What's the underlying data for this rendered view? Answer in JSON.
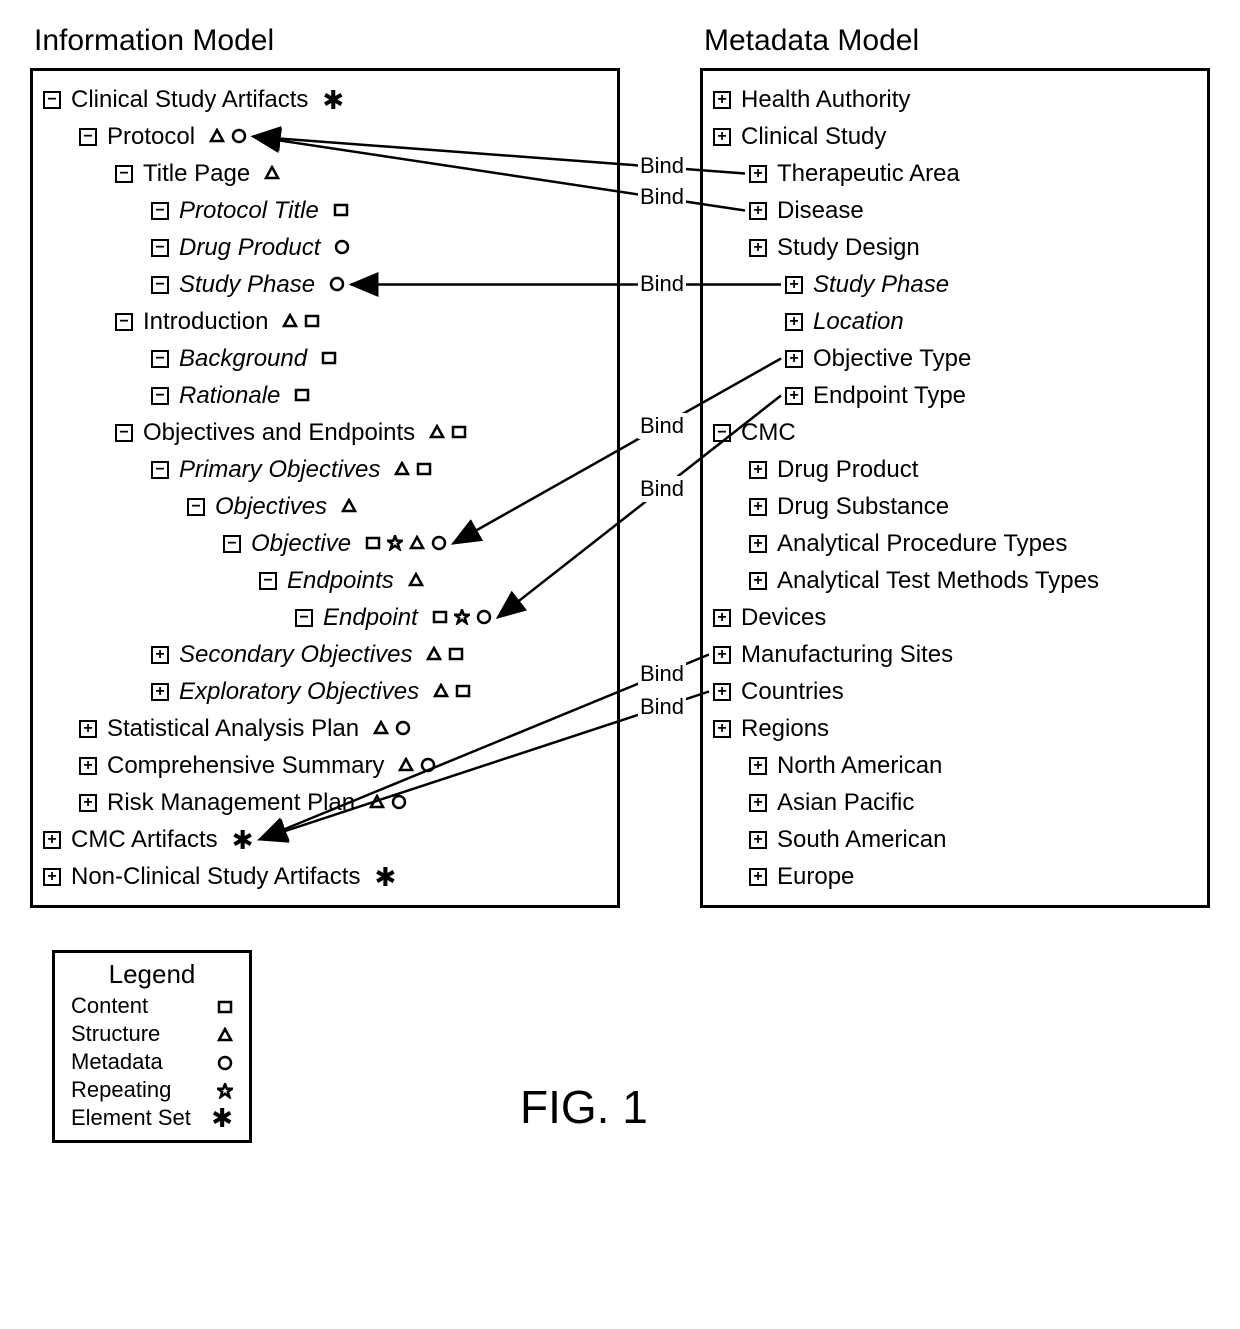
{
  "titles": {
    "information_model": "Information Model",
    "metadata_model": "Metadata Model",
    "figure": "FIG. 1"
  },
  "legend": {
    "title": "Legend",
    "items": [
      {
        "label": "Content",
        "glyph": "content"
      },
      {
        "label": "Structure",
        "glyph": "structure"
      },
      {
        "label": "Metadata",
        "glyph": "metadata"
      },
      {
        "label": "Repeating",
        "glyph": "repeating"
      },
      {
        "label": "Element Set",
        "glyph": "elementset"
      }
    ]
  },
  "info_tree": [
    {
      "id": "csa",
      "indent": 0,
      "toggle": "minus",
      "label": "Clinical Study Artifacts",
      "italic": false,
      "glyphs": [
        "elementset"
      ]
    },
    {
      "id": "proto",
      "indent": 1,
      "toggle": "minus",
      "label": "Protocol",
      "italic": false,
      "glyphs": [
        "structure",
        "metadata"
      ]
    },
    {
      "id": "title",
      "indent": 2,
      "toggle": "minus",
      "label": "Title Page",
      "italic": false,
      "glyphs": [
        "structure"
      ]
    },
    {
      "id": "pt",
      "indent": 3,
      "toggle": "minus",
      "label": "Protocol Title",
      "italic": true,
      "glyphs": [
        "content"
      ]
    },
    {
      "id": "dp",
      "indent": 3,
      "toggle": "minus",
      "label": "Drug Product",
      "italic": true,
      "glyphs": [
        "metadata"
      ]
    },
    {
      "id": "sp",
      "indent": 3,
      "toggle": "minus",
      "label": "Study Phase",
      "italic": true,
      "glyphs": [
        "metadata"
      ]
    },
    {
      "id": "intro",
      "indent": 2,
      "toggle": "minus",
      "label": "Introduction",
      "italic": false,
      "glyphs": [
        "structure",
        "content"
      ]
    },
    {
      "id": "bg",
      "indent": 3,
      "toggle": "minus",
      "label": "Background",
      "italic": true,
      "glyphs": [
        "content"
      ]
    },
    {
      "id": "rat",
      "indent": 3,
      "toggle": "minus",
      "label": "Rationale",
      "italic": true,
      "glyphs": [
        "content"
      ]
    },
    {
      "id": "oe",
      "indent": 2,
      "toggle": "minus",
      "label": "Objectives and Endpoints",
      "italic": false,
      "glyphs": [
        "structure",
        "content"
      ]
    },
    {
      "id": "po",
      "indent": 3,
      "toggle": "minus",
      "label": "Primary Objectives",
      "italic": true,
      "glyphs": [
        "structure",
        "content"
      ]
    },
    {
      "id": "objs",
      "indent": 4,
      "toggle": "minus",
      "label": "Objectives",
      "italic": true,
      "glyphs": [
        "structure"
      ]
    },
    {
      "id": "obj",
      "indent": 5,
      "toggle": "minus",
      "label": "Objective",
      "italic": true,
      "glyphs": [
        "content",
        "repeating",
        "structure",
        "metadata"
      ]
    },
    {
      "id": "eps",
      "indent": 6,
      "toggle": "minus",
      "label": "Endpoints",
      "italic": true,
      "glyphs": [
        "structure"
      ]
    },
    {
      "id": "ep",
      "indent": 7,
      "toggle": "minus",
      "label": "Endpoint",
      "italic": true,
      "glyphs": [
        "content",
        "repeating",
        "metadata"
      ]
    },
    {
      "id": "so",
      "indent": 3,
      "toggle": "plus",
      "label": "Secondary Objectives",
      "italic": true,
      "glyphs": [
        "structure",
        "content"
      ]
    },
    {
      "id": "eo",
      "indent": 3,
      "toggle": "plus",
      "label": "Exploratory Objectives",
      "italic": true,
      "glyphs": [
        "structure",
        "content"
      ]
    },
    {
      "id": "sap",
      "indent": 1,
      "toggle": "plus",
      "label": "Statistical Analysis Plan",
      "italic": false,
      "glyphs": [
        "structure",
        "metadata"
      ]
    },
    {
      "id": "cs",
      "indent": 1,
      "toggle": "plus",
      "label": "Comprehensive Summary",
      "italic": false,
      "glyphs": [
        "structure",
        "metadata"
      ]
    },
    {
      "id": "rmp",
      "indent": 1,
      "toggle": "plus",
      "label": "Risk Management Plan",
      "italic": false,
      "glyphs": [
        "structure",
        "metadata"
      ]
    },
    {
      "id": "cmca",
      "indent": 0,
      "toggle": "plus",
      "label": "CMC Artifacts",
      "italic": false,
      "glyphs": [
        "elementset"
      ]
    },
    {
      "id": "ncsa",
      "indent": 0,
      "toggle": "plus",
      "label": "Non-Clinical Study Artifacts",
      "italic": false,
      "glyphs": [
        "elementset"
      ]
    }
  ],
  "meta_tree": [
    {
      "id": "ha",
      "indent": 0,
      "toggle": "plus",
      "label": "Health Authority",
      "italic": false
    },
    {
      "id": "clin",
      "indent": 0,
      "toggle": "plus",
      "label": "Clinical Study",
      "italic": false
    },
    {
      "id": "ta",
      "indent": 1,
      "toggle": "plus",
      "label": "Therapeutic Area",
      "italic": false
    },
    {
      "id": "dis",
      "indent": 1,
      "toggle": "plus",
      "label": "Disease",
      "italic": false
    },
    {
      "id": "sd",
      "indent": 1,
      "toggle": "plus",
      "label": "Study Design",
      "italic": false
    },
    {
      "id": "msp",
      "indent": 2,
      "toggle": "plus",
      "label": "Study Phase",
      "italic": true
    },
    {
      "id": "loc",
      "indent": 2,
      "toggle": "plus",
      "label": "Location",
      "italic": true
    },
    {
      "id": "ot",
      "indent": 2,
      "toggle": "plus",
      "label": "Objective Type",
      "italic": false
    },
    {
      "id": "et",
      "indent": 2,
      "toggle": "plus",
      "label": "Endpoint Type",
      "italic": false
    },
    {
      "id": "cmc",
      "indent": 0,
      "toggle": "minus",
      "label": "CMC",
      "italic": false
    },
    {
      "id": "mdp",
      "indent": 1,
      "toggle": "plus",
      "label": "Drug Product",
      "italic": false
    },
    {
      "id": "mds",
      "indent": 1,
      "toggle": "plus",
      "label": "Drug Substance",
      "italic": false
    },
    {
      "id": "apt",
      "indent": 1,
      "toggle": "plus",
      "label": "Analytical Procedure Types",
      "italic": false
    },
    {
      "id": "atmt",
      "indent": 1,
      "toggle": "plus",
      "label": "Analytical Test Methods Types",
      "italic": false
    },
    {
      "id": "dev",
      "indent": 0,
      "toggle": "plus",
      "label": "Devices",
      "italic": false
    },
    {
      "id": "ms",
      "indent": 0,
      "toggle": "plus",
      "label": "Manufacturing Sites",
      "italic": false
    },
    {
      "id": "ctry",
      "indent": 0,
      "toggle": "plus",
      "label": "Countries",
      "italic": false
    },
    {
      "id": "reg",
      "indent": 0,
      "toggle": "plus",
      "label": "Regions",
      "italic": false
    },
    {
      "id": "na",
      "indent": 1,
      "toggle": "plus",
      "label": "North American",
      "italic": false
    },
    {
      "id": "ap",
      "indent": 1,
      "toggle": "plus",
      "label": "Asian Pacific",
      "italic": false
    },
    {
      "id": "sa",
      "indent": 1,
      "toggle": "plus",
      "label": "South American",
      "italic": false
    },
    {
      "id": "eu",
      "indent": 1,
      "toggle": "plus",
      "label": "Europe",
      "italic": false
    }
  ],
  "bindings": [
    {
      "label": "Bind",
      "from_meta": "ta",
      "to_info": "proto"
    },
    {
      "label": "Bind",
      "from_meta": "dis",
      "to_info": "proto"
    },
    {
      "label": "Bind",
      "from_meta": "msp",
      "to_info": "sp"
    },
    {
      "label": "Bind",
      "from_meta": "ot",
      "to_info": "obj"
    },
    {
      "label": "Bind",
      "from_meta": "et",
      "to_info": "ep"
    },
    {
      "label": "Bind",
      "from_meta": "ms",
      "to_info": "cmca"
    },
    {
      "label": "Bind",
      "from_meta": "ctry",
      "to_info": "cmca"
    }
  ]
}
